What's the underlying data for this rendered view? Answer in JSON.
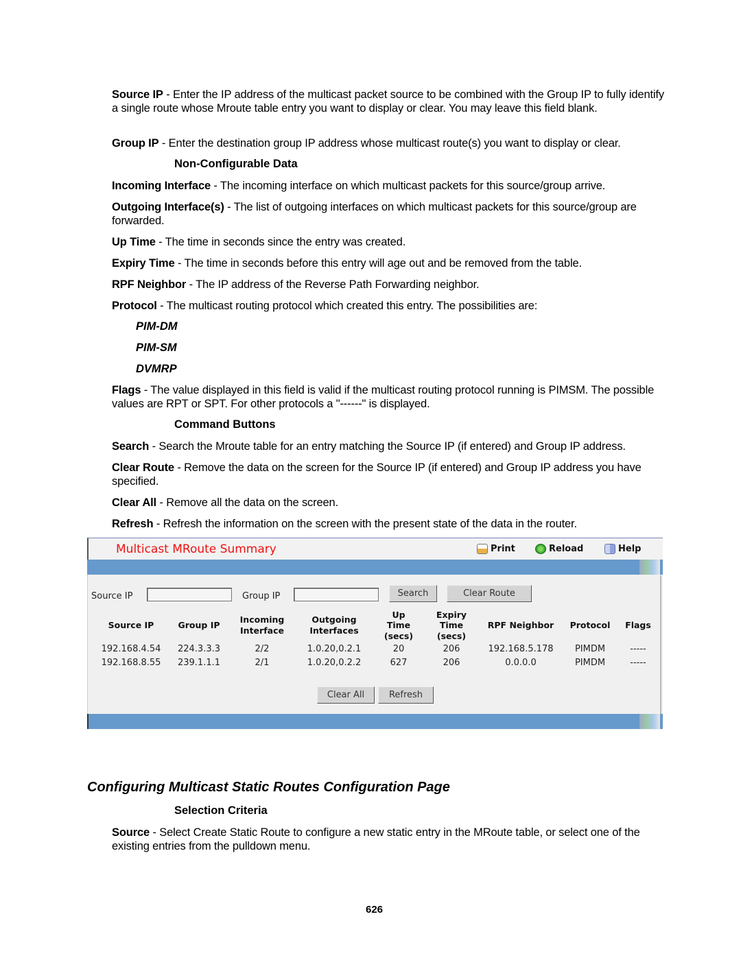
{
  "doc": {
    "source_ip": {
      "term": "Source IP",
      "text": " - Enter the IP address of the multicast packet source to be combined with the Group IP to fully identify a single route whose Mroute table entry you want to display or clear. You may leave this field blank."
    },
    "group_ip": {
      "term": "Group IP",
      "text": " - Enter the destination group IP address whose multicast route(s) you want to display or clear."
    },
    "non_configurable_heading": "Non-Configurable Data",
    "incoming_interface": {
      "term": "Incoming Interface",
      "text": " - The incoming interface on which multicast packets for this source/group arrive."
    },
    "outgoing_interfaces": {
      "term": "Outgoing Interface(s)",
      "text": " - The list of outgoing interfaces on which multicast packets for this source/group are forwarded."
    },
    "up_time": {
      "term": "Up Time",
      "text": " - The time in seconds since the entry was created."
    },
    "expiry_time": {
      "term": "Expiry Time",
      "text": " - The time in seconds before this entry will age out and be removed from the table."
    },
    "rpf_neighbor": {
      "term": "RPF Neighbor",
      "text": " - The IP address of the Reverse Path Forwarding neighbor."
    },
    "protocol": {
      "term": "Protocol",
      "text": " - The multicast routing protocol which created this entry. The possibilities are:"
    },
    "protocols": [
      "PIM-DM",
      "PIM-SM",
      "DVMRP"
    ],
    "flags": {
      "term": "Flags",
      "text": " - The value displayed in this field is valid if the multicast routing protocol running is PIMSM. The possible values are RPT or SPT. For other protocols a \"------\" is displayed."
    },
    "command_heading": "Command Buttons",
    "search": {
      "term": "Search",
      "text": " - Search the Mroute table for an entry matching the Source IP (if entered) and Group IP address."
    },
    "clear_route": {
      "term": "Clear Route",
      "text": " - Remove the data on the screen for the Source IP (if entered) and Group IP address you have specified."
    },
    "clear_all": {
      "term": "Clear All",
      "text": " - Remove all the data on the screen."
    },
    "refresh": {
      "term": "Refresh",
      "text": " - Refresh the information on the screen with the present state of the data in the router."
    },
    "section_heading": "Configuring Multicast Static Routes Configuration Page",
    "selection_heading": "Selection Criteria",
    "source": {
      "term": "Source",
      "text": " - Select Create Static Route to configure a new static entry in the MRoute table, or select one of the existing entries from the pulldown menu."
    },
    "page_number": "626"
  },
  "ui": {
    "title": "Multicast MRoute Summary",
    "toolbar": {
      "print": "Print",
      "reload": "Reload",
      "help": "Help"
    },
    "form": {
      "source_ip_label": "Source IP",
      "source_ip_value": "",
      "group_ip_label": "Group IP",
      "group_ip_value": "",
      "search_button": "Search",
      "clear_route_button": "Clear Route"
    },
    "table": {
      "headers": [
        "Source IP",
        "Group IP",
        "Incoming\nInterface",
        "Outgoing\nInterfaces",
        "Up\nTime\n(secs)",
        "Expiry\nTime\n(secs)",
        "RPF Neighbor",
        "Protocol",
        "Flags"
      ],
      "rows": [
        [
          "192.168.4.54",
          "224.3.3.3",
          "2/2",
          "1.0.20,0.2.1",
          "20",
          "206",
          "192.168.5.178",
          "PIMDM",
          "-----"
        ],
        [
          "192.168.8.55",
          "239.1.1.1",
          "2/1",
          "1.0.20,0.2.2",
          "627",
          "206",
          "0.0.0.0",
          "PIMDM",
          "-----"
        ]
      ]
    },
    "clear_all_button": "Clear All",
    "refresh_button": "Refresh",
    "colors": {
      "title": "#ee1111",
      "bar": "#6699cc",
      "panel": "#f0f0f0"
    }
  }
}
